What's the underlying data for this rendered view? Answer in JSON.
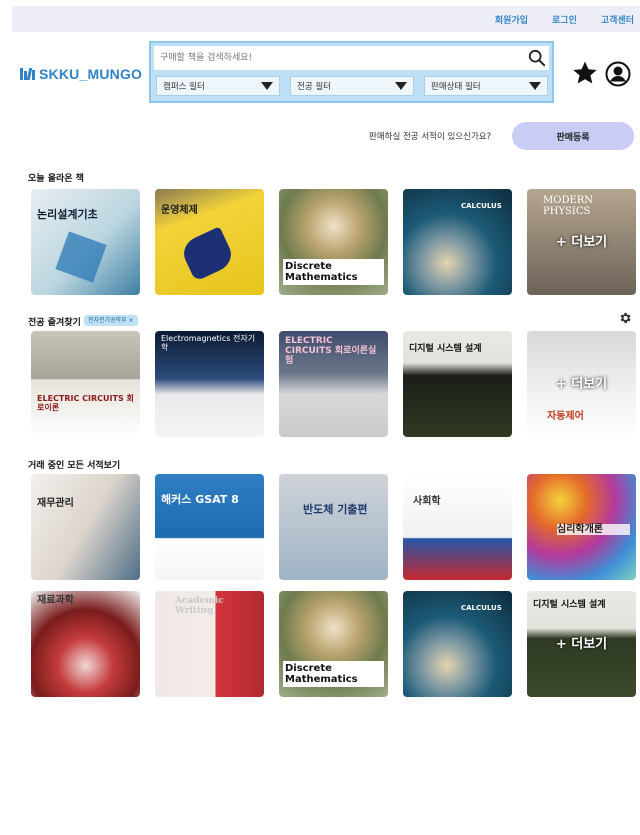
{
  "top_nav": {
    "signup": "회원가입",
    "login": "로그인",
    "support": "고객센터"
  },
  "logo": {
    "text": "SKKU_MUNGO",
    "icon": "books-icon"
  },
  "search": {
    "placeholder": "구매할 책을 검색하세요!",
    "filters": [
      "캠퍼스 필터",
      "전공 필터",
      "판매상태 필터"
    ]
  },
  "header_icons": [
    "star-icon",
    "user-icon"
  ],
  "sell": {
    "prompt": "판매하실 전공 서적이 있으신가요?",
    "button": "판매등록"
  },
  "sections": {
    "today": {
      "title": "오늘 올라온 책",
      "books": [
        {
          "title": "논리설계기초",
          "more": ""
        },
        {
          "title": "운영체제",
          "more": ""
        },
        {
          "title": "Discrete Mathematics",
          "more": ""
        },
        {
          "title": "CALCULUS",
          "more": ""
        },
        {
          "title": "MODERN PHYSICS",
          "more": "+ 더보기"
        }
      ]
    },
    "major": {
      "title": "전공 즐겨찾기",
      "tag": "전자전기공학부 ×",
      "books": [
        {
          "title": "ELECTRIC CIRCUITS 회로이론",
          "more": ""
        },
        {
          "title": "Electromagnetics 전자기학",
          "more": ""
        },
        {
          "title": "ELECTRIC CIRCUITS 회로이론실험",
          "more": ""
        },
        {
          "title": "디지털 시스템 설계",
          "more": ""
        },
        {
          "title": "자동제어",
          "more": "+ 더보기"
        }
      ]
    },
    "all": {
      "title": "거래 중인 모든 서적보기",
      "rows": [
        [
          {
            "title": "재무관리",
            "more": ""
          },
          {
            "title": "해커스 GSAT 8",
            "more": ""
          },
          {
            "title": "반도체 기출편",
            "more": ""
          },
          {
            "title": "사회학",
            "more": ""
          },
          {
            "title": "심리학개론",
            "more": ""
          }
        ],
        [
          {
            "title": "재료과학",
            "more": ""
          },
          {
            "title": "Academic Writing",
            "more": ""
          },
          {
            "title": "Discrete Mathematics",
            "more": ""
          },
          {
            "title": "CALCULUS",
            "more": ""
          },
          {
            "title": "디지털 시스템 설계",
            "more": "+ 더보기"
          }
        ]
      ]
    }
  }
}
